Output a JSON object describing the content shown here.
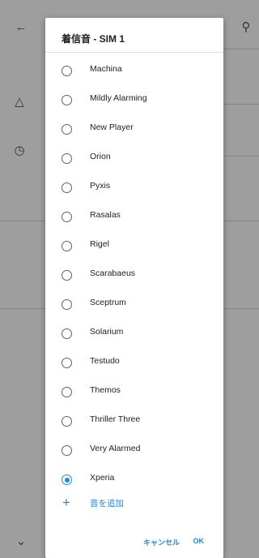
{
  "background": {
    "icons": [
      "back-arrow-icon",
      "search-icon",
      "bell-icon",
      "alarm-icon",
      "chevron-down-icon"
    ]
  },
  "dialog": {
    "title": "着信音 - SIM 1",
    "items": [
      {
        "label": "Machina",
        "checked": false
      },
      {
        "label": "Mildly Alarming",
        "checked": false
      },
      {
        "label": "New Player",
        "checked": false
      },
      {
        "label": "Orion",
        "checked": false
      },
      {
        "label": "Pyxis",
        "checked": false
      },
      {
        "label": "Rasalas",
        "checked": false
      },
      {
        "label": "Rigel",
        "checked": false
      },
      {
        "label": "Scarabaeus",
        "checked": false
      },
      {
        "label": "Sceptrum",
        "checked": false
      },
      {
        "label": "Solarium",
        "checked": false
      },
      {
        "label": "Testudo",
        "checked": false
      },
      {
        "label": "Themos",
        "checked": false
      },
      {
        "label": "Thriller Three",
        "checked": false
      },
      {
        "label": "Very Alarmed",
        "checked": false
      },
      {
        "label": "Xperia",
        "checked": true
      }
    ],
    "add_sound": {
      "icon": "plus-icon",
      "label": "音を追加"
    },
    "cancel_label": "キャンセル",
    "ok_label": "OK"
  },
  "colors": {
    "accent": "#1e88e5",
    "text": "#212121",
    "radio_unchecked": "#616161"
  }
}
